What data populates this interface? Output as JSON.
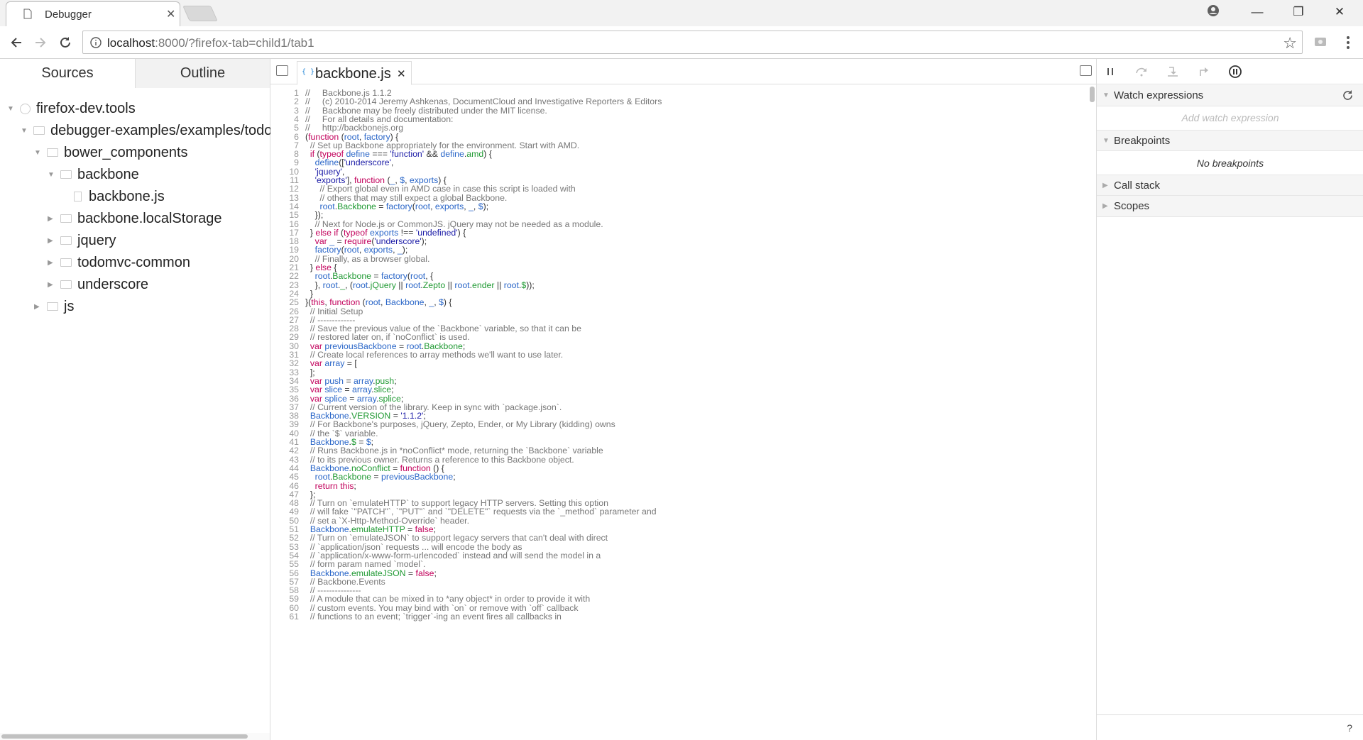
{
  "browser": {
    "tab_title": "Debugger",
    "url_host": "localhost",
    "url_rest": ":8000/?firefox-tab=child1/tab1"
  },
  "left_panel": {
    "tabs": [
      "Sources",
      "Outline"
    ],
    "tree": [
      {
        "label": "firefox-dev.tools",
        "kind": "globe",
        "expanded": true,
        "depth": 0
      },
      {
        "label": "debugger-examples/examples/todo",
        "kind": "folder",
        "expanded": true,
        "depth": 1
      },
      {
        "label": "bower_components",
        "kind": "folder",
        "expanded": true,
        "depth": 2
      },
      {
        "label": "backbone",
        "kind": "folder",
        "expanded": true,
        "depth": 3
      },
      {
        "label": "backbone.js",
        "kind": "file",
        "expanded": false,
        "depth": 4
      },
      {
        "label": "backbone.localStorage",
        "kind": "folder",
        "expanded": false,
        "depth": 3
      },
      {
        "label": "jquery",
        "kind": "folder",
        "expanded": false,
        "depth": 3
      },
      {
        "label": "todomvc-common",
        "kind": "folder",
        "expanded": false,
        "depth": 3
      },
      {
        "label": "underscore",
        "kind": "folder",
        "expanded": false,
        "depth": 3
      },
      {
        "label": "js",
        "kind": "folder",
        "expanded": false,
        "depth": 2
      }
    ]
  },
  "editor": {
    "file_tab": "backbone.js",
    "lines": [
      "//     Backbone.js 1.1.2",
      "//     (c) 2010-2014 Jeremy Ashkenas, DocumentCloud and Investigative Reporters & Editors",
      "//     Backbone may be freely distributed under the MIT license.",
      "//     For all details and documentation:",
      "//     http://backbonejs.org",
      "(function (root, factory) {",
      "  // Set up Backbone appropriately for the environment. Start with AMD.",
      "  if (typeof define === 'function' && define.amd) {",
      "    define(['underscore',",
      "    'jquery',",
      "    'exports'], function (_, $, exports) {",
      "      // Export global even in AMD case in case this script is loaded with",
      "      // others that may still expect a global Backbone.",
      "      root.Backbone = factory(root, exports, _, $);",
      "    });",
      "    // Next for Node.js or CommonJS. jQuery may not be needed as a module.",
      "  } else if (typeof exports !== 'undefined') {",
      "    var _ = require('underscore');",
      "    factory(root, exports, _);",
      "    // Finally, as a browser global.",
      "  } else {",
      "    root.Backbone = factory(root, {",
      "    }, root._, (root.jQuery || root.Zepto || root.ender || root.$));",
      "  }",
      "}(this, function (root, Backbone, _, $) {",
      "  // Initial Setup",
      "  // -------------",
      "  // Save the previous value of the `Backbone` variable, so that it can be",
      "  // restored later on, if `noConflict` is used.",
      "  var previousBackbone = root.Backbone;",
      "  // Create local references to array methods we'll want to use later.",
      "  var array = [",
      "  ];",
      "  var push = array.push;",
      "  var slice = array.slice;",
      "  var splice = array.splice;",
      "  // Current version of the library. Keep in sync with `package.json`.",
      "  Backbone.VERSION = '1.1.2';",
      "  // For Backbone's purposes, jQuery, Zepto, Ender, or My Library (kidding) owns",
      "  // the `$` variable.",
      "  Backbone.$ = $;",
      "  // Runs Backbone.js in *noConflict* mode, returning the `Backbone` variable",
      "  // to its previous owner. Returns a reference to this Backbone object.",
      "  Backbone.noConflict = function () {",
      "    root.Backbone = previousBackbone;",
      "    return this;",
      "  };",
      "  // Turn on `emulateHTTP` to support legacy HTTP servers. Setting this option",
      "  // will fake `\"PATCH\"`, `\"PUT\"` and `\"DELETE\"` requests via the `_method` parameter and",
      "  // set a `X-Http-Method-Override` header.",
      "  Backbone.emulateHTTP = false;",
      "  // Turn on `emulateJSON` to support legacy servers that can't deal with direct",
      "  // `application/json` requests ... will encode the body as",
      "  // `application/x-www-form-urlencoded` instead and will send the model in a",
      "  // form param named `model`.",
      "  Backbone.emulateJSON = false;",
      "  // Backbone.Events",
      "  // ---------------",
      "  // A module that can be mixed in to *any object* in order to provide it with",
      "  // custom events. You may bind with `on` or remove with `off` callback",
      "  // functions to an event; `trigger`-ing an event fires all callbacks in"
    ]
  },
  "right_panel": {
    "watch_header": "Watch expressions",
    "watch_placeholder": "Add watch expression",
    "breakpoints_header": "Breakpoints",
    "breakpoints_empty": "No breakpoints",
    "callstack_header": "Call stack",
    "scopes_header": "Scopes",
    "help": "?"
  },
  "colors": {
    "comment": "#777777",
    "keyword": "#c2005b",
    "identifier": "#2a66c8",
    "property": "#219a34",
    "string": "#1a1aa6"
  }
}
